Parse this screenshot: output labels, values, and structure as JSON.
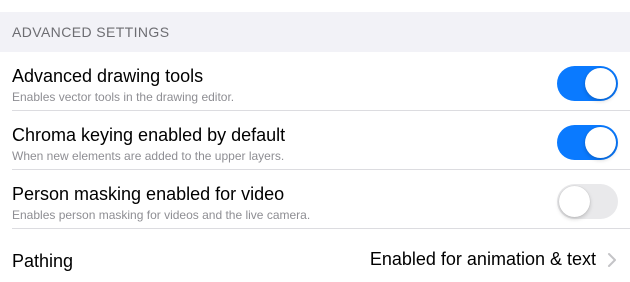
{
  "section": {
    "header": "ADVANCED SETTINGS"
  },
  "rows": [
    {
      "title": "Advanced drawing tools",
      "subtitle": "Enables vector tools in the drawing editor.",
      "toggle_on": true
    },
    {
      "title": "Chroma keying enabled by default",
      "subtitle": "When new elements are added to the upper layers.",
      "toggle_on": true
    },
    {
      "title": "Person masking enabled for video",
      "subtitle": "Enables person masking for videos and the live camera.",
      "toggle_on": false
    }
  ],
  "pathing": {
    "label": "Pathing",
    "value": "Enabled for animation & text",
    "icon": "chevron-right-icon"
  },
  "colors": {
    "toggle_on": "#0a7aff",
    "toggle_off": "#e9e9eb",
    "section_background": "#f2f2f7"
  }
}
